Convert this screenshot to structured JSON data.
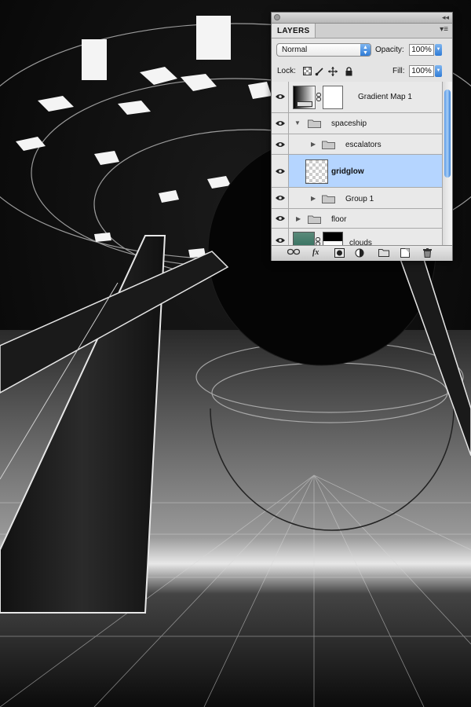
{
  "panel": {
    "tab_label": "LAYERS",
    "collapse_glyph": "◂◂",
    "menu_glyph": "▾≡",
    "blend_mode": "Normal",
    "opacity_label": "Opacity:",
    "opacity_value": "100%",
    "lock_label": "Lock:",
    "fill_label": "Fill:",
    "fill_value": "100%"
  },
  "layers": [
    {
      "name": "Gradient Map 1",
      "type": "adjustment",
      "selected": false
    },
    {
      "name": "spaceship",
      "type": "group",
      "expanded": true,
      "selected": false
    },
    {
      "name": "escalators",
      "type": "group",
      "expanded": false,
      "selected": false
    },
    {
      "name": "gridglow",
      "type": "pixel",
      "selected": true
    },
    {
      "name": "Group 1",
      "type": "group",
      "expanded": false,
      "selected": false
    },
    {
      "name": "floor",
      "type": "group",
      "expanded": false,
      "selected": false
    },
    {
      "name": "clouds",
      "type": "pixel-masked",
      "selected": false
    }
  ],
  "icons": {
    "eye": "eye-icon",
    "folder": "folder-icon",
    "link": "link-icon"
  },
  "bottom_bar": {
    "fx_label": "fx"
  },
  "colors": {
    "selection": "#b5d5ff",
    "accent": "#2f7bd6"
  }
}
